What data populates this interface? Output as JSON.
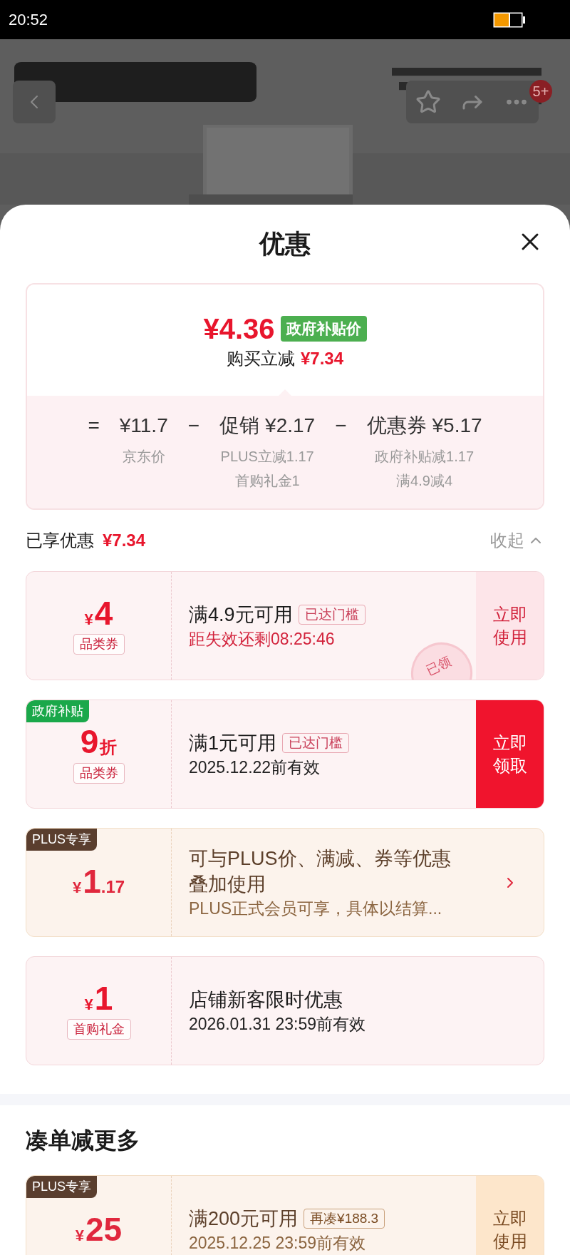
{
  "status_bar": {
    "time": "20:52"
  },
  "product_header": {
    "notification_badge": "5+"
  },
  "sheet": {
    "title": "优惠"
  },
  "price_summary": {
    "final_price": "¥4.36",
    "price_tag": "政府补贴价",
    "saving_label": "购买立减",
    "saving_amount": "¥7.34",
    "breakdown": [
      {
        "operator": "=",
        "amount": "¥11.7",
        "notes": [
          "京东价"
        ]
      },
      {
        "operator": "−",
        "label": "促销",
        "amount": "¥2.17",
        "notes": [
          "PLUS立减1.17",
          "首购礼金1"
        ]
      },
      {
        "operator": "−",
        "label": "优惠券",
        "amount": "¥5.17",
        "notes": [
          "政府补贴减1.17",
          "满4.9减4"
        ]
      }
    ]
  },
  "enjoyed": {
    "label": "已享优惠",
    "amount": "¥7.34",
    "toggle": "收起",
    "expanded": true
  },
  "coupons": [
    {
      "kind": "standard",
      "amount": {
        "currency": "¥",
        "value": "4"
      },
      "type_label": "品类券",
      "title": "满4.9元可用",
      "threshold_tag": "已达门槛",
      "subtitle": "距失效还剩08:25:46",
      "countdown": true,
      "action": {
        "kind": "light",
        "label": "立即使用"
      },
      "stamp": "已领"
    },
    {
      "kind": "standard",
      "badge": {
        "text": "政府补贴",
        "color": "#1aa84a"
      },
      "amount": {
        "value": "9",
        "unit": "折"
      },
      "type_label": "品类券",
      "title": "满1元可用",
      "threshold_tag": "已达门槛",
      "subtitle": "2025.12.22前有效",
      "countdown": false,
      "action": {
        "kind": "solid",
        "label": "立即领取"
      }
    },
    {
      "kind": "plus",
      "badge": {
        "text": "PLUS专享",
        "color": "#5a3e2e"
      },
      "amount": {
        "currency": "¥",
        "value": "1",
        "decimal": ".17"
      },
      "title": "可与PLUS价、满减、券等优惠叠加使用",
      "subtitle": "PLUS正式会员可享，具体以结算...",
      "countdown": false,
      "action": {
        "kind": "arrow"
      }
    },
    {
      "kind": "standard",
      "amount": {
        "currency": "¥",
        "value": "1"
      },
      "type_label": "首购礼金",
      "title": "店铺新客限时优惠",
      "subtitle": "2026.01.31 23:59前有效",
      "countdown": false
    }
  ],
  "more_section": {
    "title": "凑单减更多",
    "coupons": [
      {
        "kind": "plus",
        "badge": {
          "text": "PLUS专享",
          "color": "#5a3e2e"
        },
        "amount": {
          "currency": "¥",
          "value": "25"
        },
        "title": "满200元可用",
        "threshold_tag": "再凑¥188.3",
        "subtitle": "2025.12.25 23:59前有效",
        "countdown": false,
        "action": {
          "kind": "light",
          "label": "立即使用"
        }
      }
    ]
  }
}
